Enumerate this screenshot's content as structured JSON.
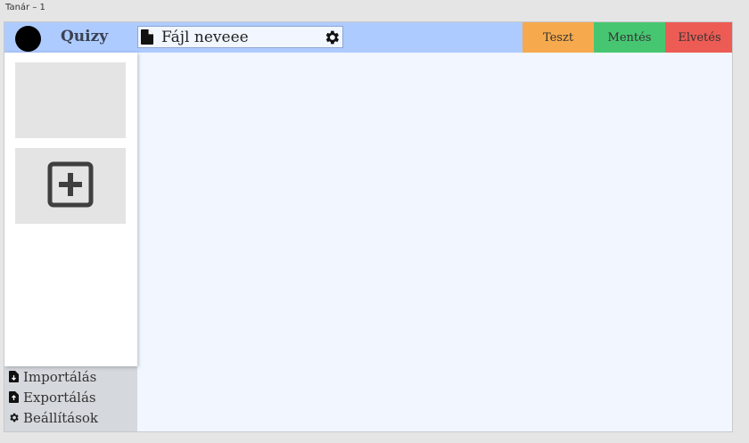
{
  "artboard": {
    "label": "Tanár – 1"
  },
  "header": {
    "brand": "Quizy",
    "file_name": "Fájl neveee",
    "buttons": {
      "test": "Teszt",
      "save": "Mentés",
      "discard": "Elvetés"
    }
  },
  "sidebar": {
    "slides": [
      {
        "type": "empty"
      }
    ],
    "add_slide_icon": "add-box-icon",
    "menu": [
      {
        "label": "Importálás",
        "icon": "file-import-icon"
      },
      {
        "label": "Exportálás",
        "icon": "file-export-icon"
      },
      {
        "label": "Beállítások",
        "icon": "gear-icon"
      }
    ]
  },
  "colors": {
    "header_bg": "#aecbff",
    "canvas_bg": "#f1f6ff",
    "test": "#f6aa4d",
    "save": "#47c671",
    "discard": "#ec5c55"
  }
}
